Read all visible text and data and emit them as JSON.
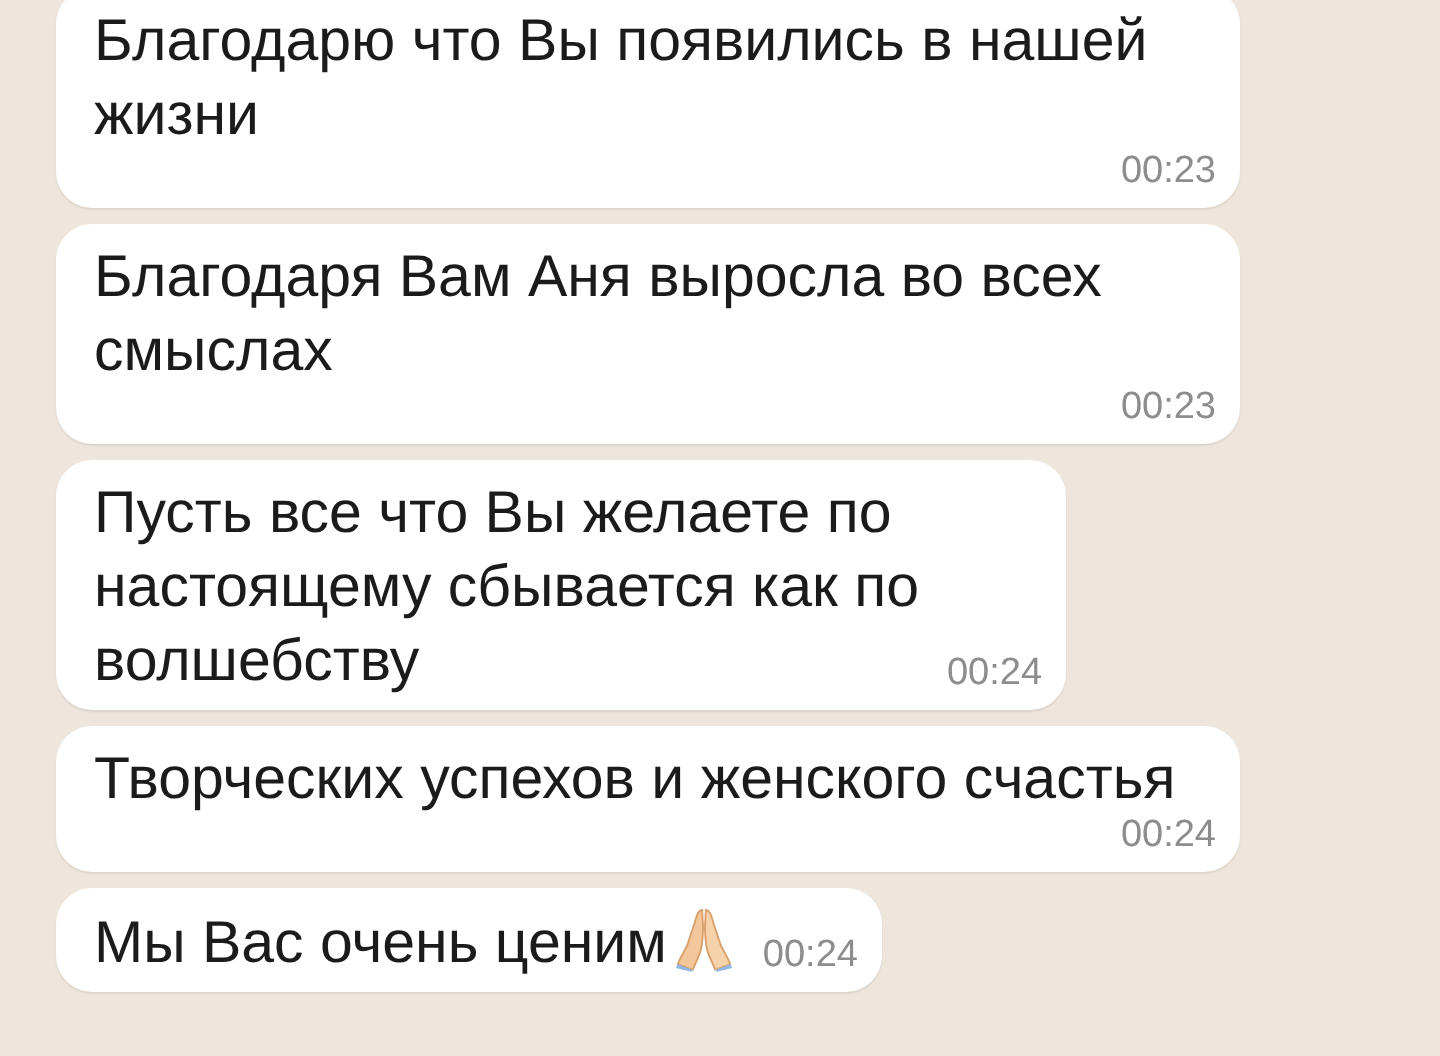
{
  "messages": [
    {
      "lines": [
        "Благодарю что Вы появились в нашей",
        "жизни"
      ],
      "time": "00:23",
      "has_icon": false
    },
    {
      "lines": [
        "Благодаря Вам Аня выросла во всех",
        "смыслах"
      ],
      "time": "00:23",
      "has_icon": false
    },
    {
      "lines": [
        "Пусть все что Вы желаете по",
        "настоящему сбывается как по",
        "волшебству"
      ],
      "time": "00:24",
      "has_icon": false
    },
    {
      "lines": [
        "Творческих успехов и женского счастья"
      ],
      "time": "00:24",
      "has_icon": false
    },
    {
      "lines": [
        "Мы Вас очень ценим"
      ],
      "time": "00:24",
      "has_icon": true
    }
  ]
}
